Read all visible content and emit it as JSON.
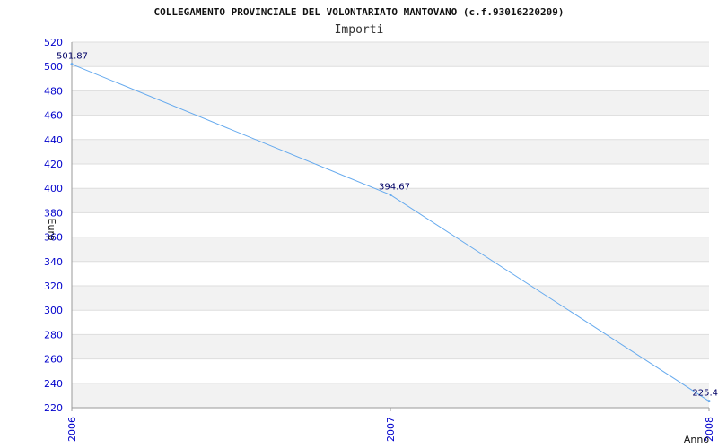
{
  "chart_data": {
    "type": "line",
    "title": "COLLEGAMENTO PROVINCIALE DEL VOLONTARIATO MANTOVANO (c.f.93016220209)",
    "subtitle": "Importi",
    "xlabel": "Anno",
    "ylabel": "Euro",
    "categories": [
      "2006",
      "2007",
      "2008"
    ],
    "series": [
      {
        "values": [
          501.87,
          394.67,
          225.4
        ],
        "labels": [
          "501.87",
          "394.67",
          "225.4"
        ]
      }
    ],
    "ylim": [
      220,
      520
    ],
    "yticks": [
      "220",
      "240",
      "260",
      "280",
      "300",
      "320",
      "340",
      "360",
      "380",
      "400",
      "420",
      "440",
      "460",
      "480",
      "500",
      "520"
    ],
    "grid": true,
    "colors": {
      "line": "#66aaee",
      "band": "#f2f2f2",
      "tick": "#0000cc",
      "grid": "#dddddd"
    }
  }
}
